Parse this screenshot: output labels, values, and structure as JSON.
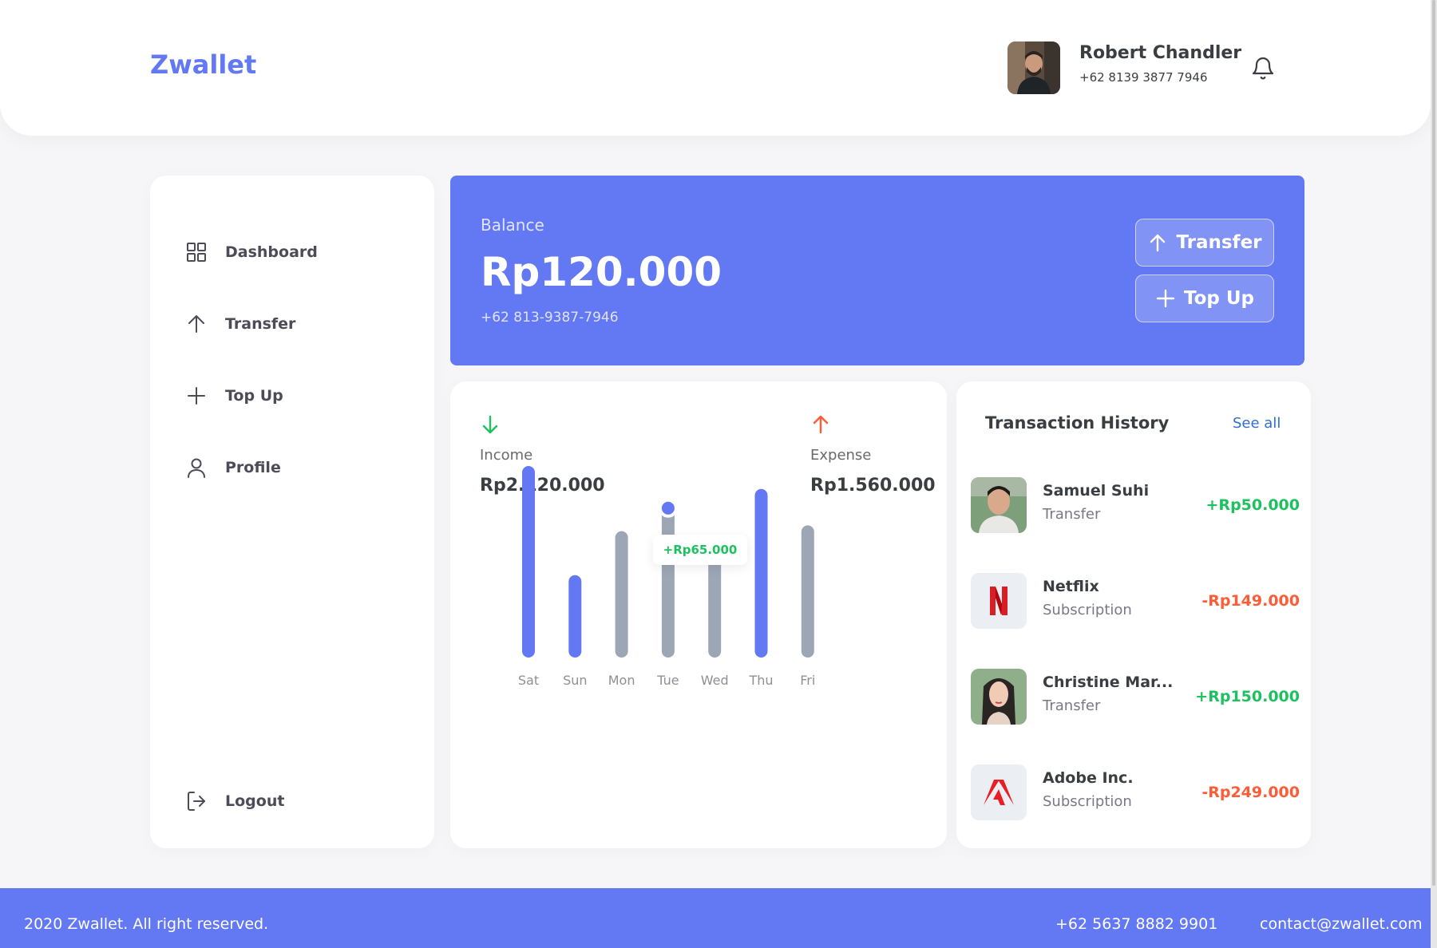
{
  "app": {
    "logo": "Zwallet"
  },
  "header": {
    "user_name": "Robert Chandler",
    "user_phone": "+62 8139 3877 7946"
  },
  "sidebar": {
    "items": [
      {
        "label": "Dashboard",
        "icon": "grid-icon"
      },
      {
        "label": "Transfer",
        "icon": "arrow-up-icon"
      },
      {
        "label": "Top Up",
        "icon": "plus-icon"
      },
      {
        "label": "Profile",
        "icon": "user-icon"
      }
    ],
    "logout_label": "Logout"
  },
  "balance": {
    "label": "Balance",
    "amount": "Rp120.000",
    "phone": "+62 813-9387-7946",
    "transfer_label": "Transfer",
    "topup_label": "Top Up"
  },
  "stats": {
    "income_label": "Income",
    "income_value": "Rp2.120.000",
    "expense_label": "Expense",
    "expense_value": "Rp1.560.000",
    "tooltip": "+Rp65.000"
  },
  "chart_data": {
    "type": "bar",
    "categories": [
      "Sat",
      "Sun",
      "Mon",
      "Tue",
      "Wed",
      "Thu",
      "Fri"
    ],
    "values": [
      1.0,
      0.43,
      0.66,
      0.78,
      0.61,
      0.88,
      0.69
    ],
    "kinds": [
      "income",
      "income",
      "expense",
      "expense",
      "expense",
      "income",
      "expense"
    ],
    "highlight_index": 3,
    "colors": {
      "income": "#6379f4",
      "expense": "#9da6b5"
    }
  },
  "history": {
    "title": "Transaction History",
    "see_all": "See all",
    "items": [
      {
        "name": "Samuel Suhi",
        "type": "Transfer",
        "amount": "+Rp50.000",
        "sign": "pos",
        "image": "photo-avatar"
      },
      {
        "name": "Netflix",
        "type": "Subscription",
        "amount": "-Rp149.000",
        "sign": "neg",
        "image": "netflix-logo"
      },
      {
        "name": "Christine Mar...",
        "type": "Transfer",
        "amount": "+Rp150.000",
        "sign": "pos",
        "image": "photo-avatar"
      },
      {
        "name": "Adobe Inc.",
        "type": "Subscription",
        "amount": "-Rp249.000",
        "sign": "neg",
        "image": "adobe-logo"
      }
    ]
  },
  "footer": {
    "copyright": "2020 Zwallet. All right reserved.",
    "phone": "+62 5637 8882 9901",
    "email": "contact@zwallet.com"
  }
}
